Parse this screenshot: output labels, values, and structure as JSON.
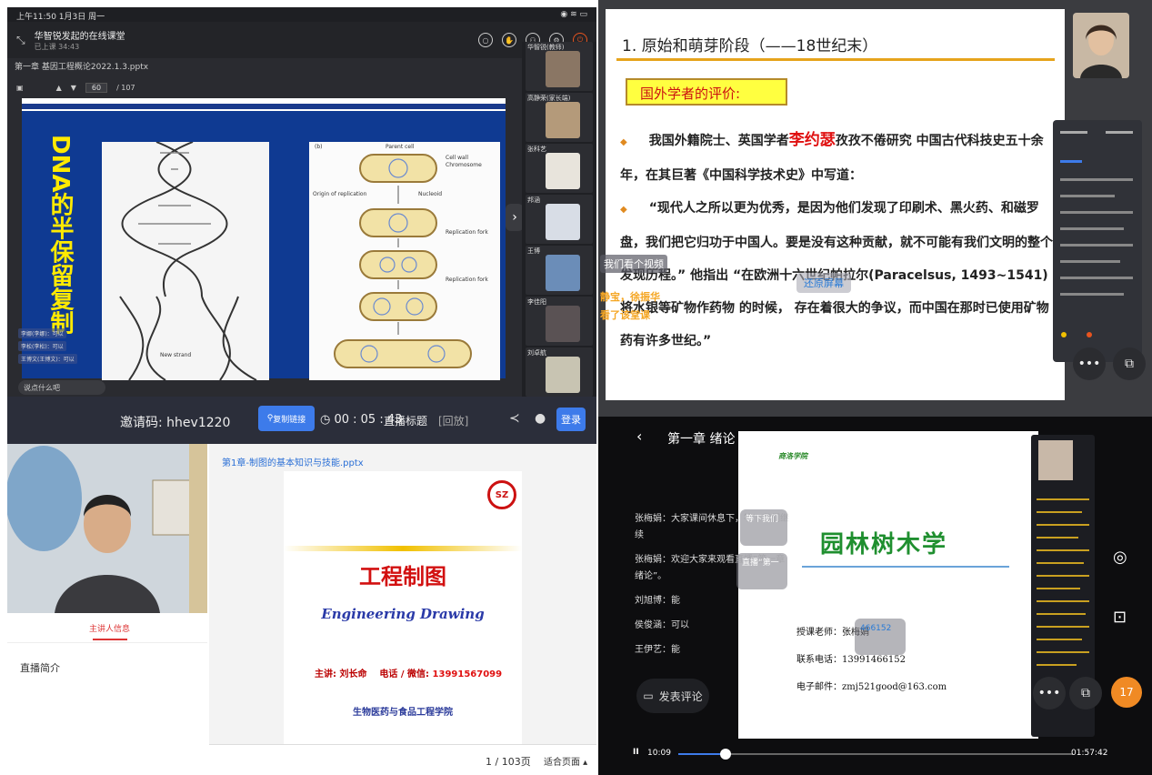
{
  "q1": {
    "status_time": "上午11:50  1月3日 周一",
    "status_right": "◉ ≋ ▭",
    "meeting_title": "华智锐发起的在线课堂",
    "meeting_time": "已上课 34:43",
    "file_name": "第一章 基因工程概论2022.1.3.pptx",
    "page": "60",
    "page_total": "/ 107",
    "slide_title": "DNA的半保留复制",
    "captions": [
      "Parent cell",
      "Cell wall",
      "Chromosome",
      "Origin of replication",
      "Nucleoid",
      "Replication fork",
      "Replication fork",
      "New strand"
    ],
    "participants": [
      "华智锐(教师)",
      "高静荣(家长端)",
      "张科艺",
      "邦涵",
      "王博",
      "李佳阳",
      "刘卓航"
    ],
    "chat": [
      "李娜(李娜)：可以",
      "李松(李松)：可以",
      "王博文(王博文)：可以"
    ],
    "input_placeholder": "说点什么吧",
    "next_arrow": "›"
  },
  "q2": {
    "title": "1. 原始和萌芽阶段（——18世纪末）",
    "box": "国外学者的评价:",
    "para1_pre": "我国外籍院士、英国学者",
    "para1_red": "李约瑟",
    "para1_post": "孜孜不倦研究 中国古代科技史五十余年，在其巨著《中国科学技术史》中写道：",
    "para2": "“现代人之所以更为优秀，是因为他们发现了印刷术、黑火药、和磁罗盘，我们把它归功于中国人。要是没有这种贡献，就不可能有我们文明的整个发现历程。”  他指出 “在欧洲十六世纪帕拉尔(Paracelsus, 1493~1541) 将水银等矿物作药物 的时候， 存在着很大的争议，而中国在那时已使用矿物药有许多世纪。”",
    "danmu1": "我们看个视频",
    "danmu2": "静宝，徐振华",
    "danmu3": "看了该堂课",
    "danmu4": "还原屏幕",
    "more": "•••",
    "cast": "⧉",
    "pip": "◧"
  },
  "q3": {
    "invite_label": "邀请码:",
    "invite_code": "hhev1220",
    "copy_label": "复制链接",
    "timer": "◷ 00 : 05 : 43",
    "live_title": "直播标题",
    "replay": "[回放]",
    "share": "≺",
    "chat": "●",
    "login": "登录",
    "tab_lecturer": "主讲人信息",
    "intro_label": "直播简介",
    "ppt_name": "第1章-制图的基本知识与技能.pptx",
    "seal_text": "SZ",
    "slide_title": "工程制图",
    "slide_subtitle": "Engineering Drawing",
    "lecturer_label": "主讲: 刘长命",
    "phone_label": "电话 / 微信:",
    "phone": "13991567099",
    "college": "生物医药与食品工程学院",
    "page_indicator": "1 / 103页",
    "fit_page": "适合页面 ▴"
  },
  "q4": {
    "back": "‹",
    "course_title": "第一章 绪论",
    "school": "商洛学院",
    "slide_title": "园林树木学",
    "teacher": "授课老师：张梅娟",
    "phone": "联系电话：13991466152",
    "email": "电子邮件：zmj521good@163.com",
    "comments": [
      {
        "user": "张梅娟",
        "text": "大家课间休息下，等下我们继续"
      },
      {
        "user": "张梅娟",
        "text": "欢迎大家来观看直播“第一章 绪论”。"
      },
      {
        "user": "刘旭博",
        "text": "能"
      },
      {
        "user": "侯俊涵",
        "text": "可以"
      },
      {
        "user": "王伊艺",
        "text": "能"
      }
    ],
    "pill1": "等下我们",
    "pill2": "直播“第一",
    "pill3": "466152",
    "post_comment": "发表评论",
    "play": "II",
    "current_time": "10:09",
    "total_time": "01:57:42",
    "like_count": "17",
    "progress": 0.12
  },
  "colors": {
    "accent_blue": "#3d7bea",
    "slide_blue": "#0f3a92",
    "title_yellow": "#ffea00",
    "red": "#d21010",
    "green": "#1f8f2f",
    "orange": "#f08a24"
  }
}
